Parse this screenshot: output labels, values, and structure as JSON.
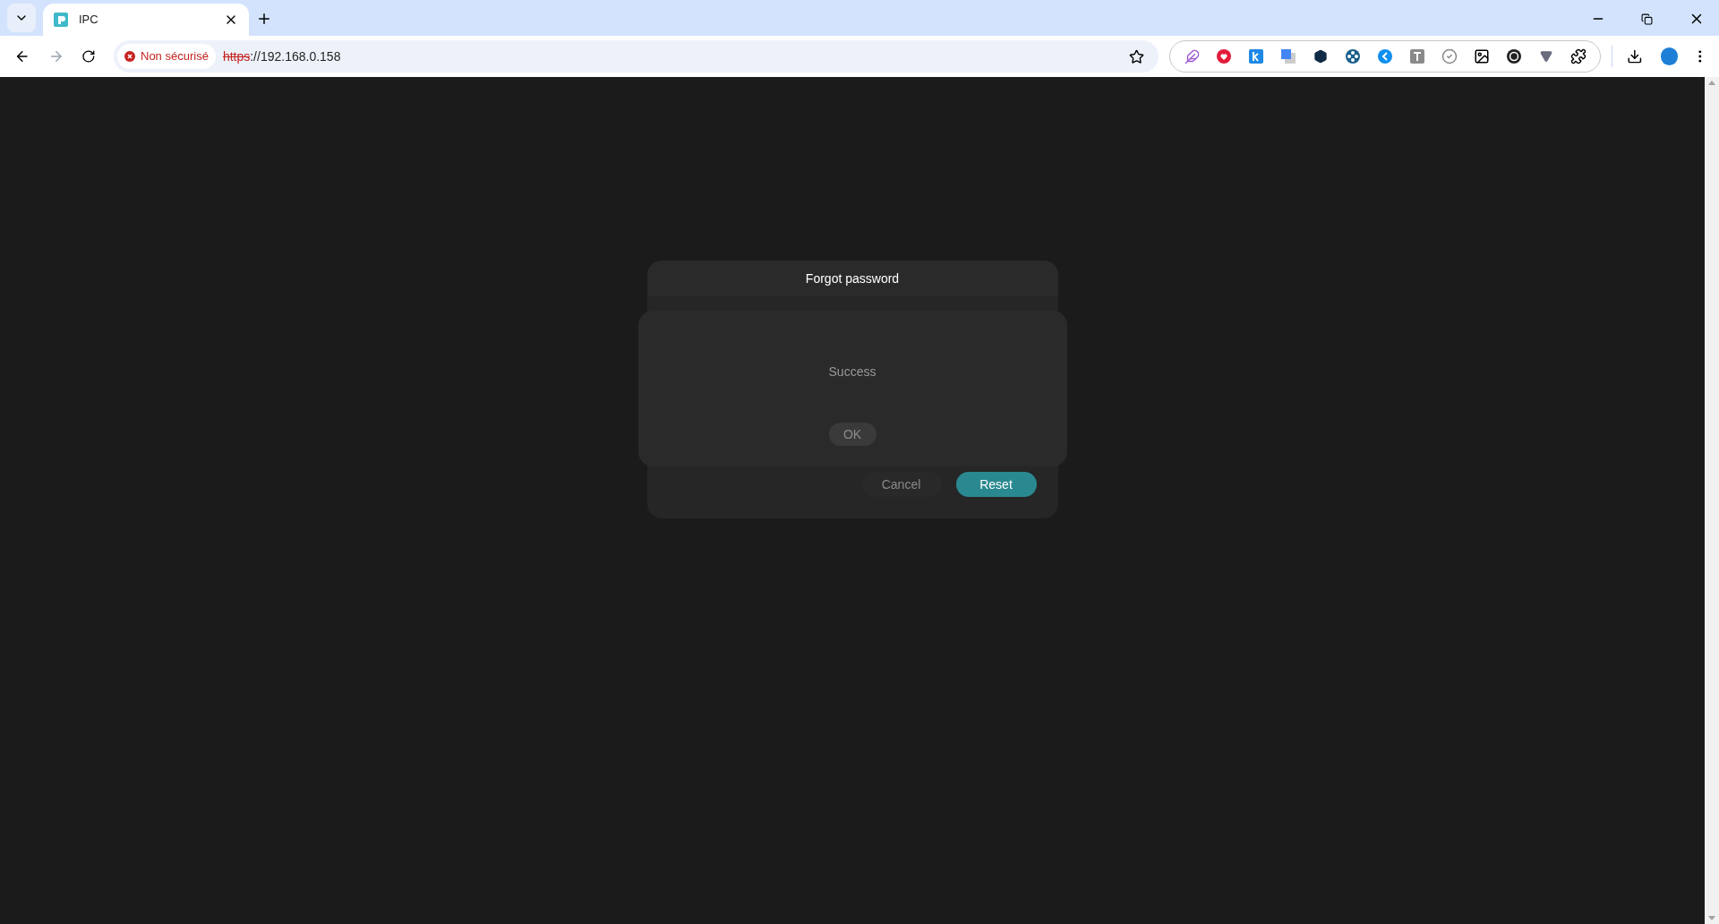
{
  "browser": {
    "tabs": [
      {
        "title": "IPC",
        "selected": true
      }
    ],
    "address_bar": {
      "security_label": "Non sécurisé",
      "secure": false,
      "scheme": "https",
      "rest": "://192.168.0.158"
    }
  },
  "dialog": {
    "title": "Forgot password",
    "buttons": [
      {
        "label": "Cancel",
        "kind": "secondary"
      },
      {
        "label": "Reset",
        "kind": "primary"
      }
    ]
  },
  "popup": {
    "message": "Success",
    "button": "OK"
  }
}
